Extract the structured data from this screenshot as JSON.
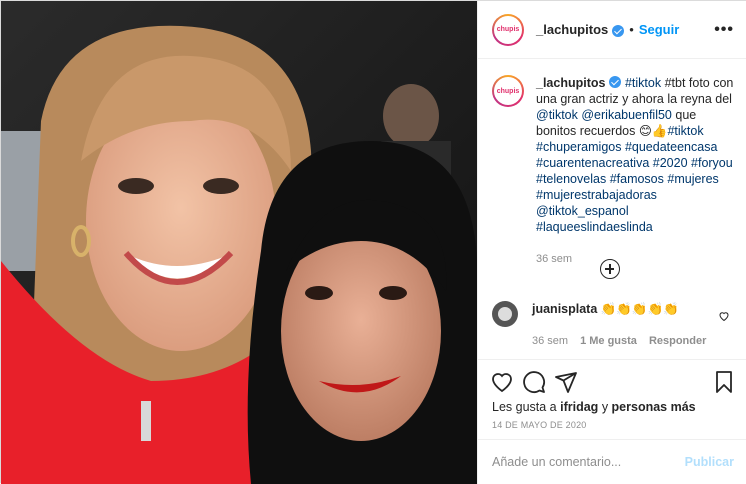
{
  "post": {
    "username": "_lachupitos",
    "follow_label": "Seguir",
    "more_label": "•••",
    "avatar_text": "chupis"
  },
  "caption": {
    "username": "_lachupitos",
    "text_intro": "#tbt foto con una gran actriz y ahora la reyna del",
    "mention_tiktok": "@tiktok",
    "mention_erika": "@erikabuenfil50",
    "text_mid": "que bonitos recuerdos",
    "emoji": "😊👍",
    "hashtags": [
      "#tiktok",
      "#chuperamigos",
      "#quedateencasa",
      "#cuarentenacreativa",
      "#2020",
      "#foryou",
      "#telenovelas",
      "#famosos",
      "#mujeres",
      "#mujerestrabajadoras",
      "@tiktok_espanol",
      "#laqueeslindaeslinda"
    ],
    "age": "36 sem"
  },
  "reply": {
    "username": "juanisplata",
    "text": "👏👏👏👏👏",
    "age": "36 sem",
    "likes": "1 Me gusta",
    "reply_label": "Responder"
  },
  "actions": {
    "likes_prefix": "Les gusta a",
    "liked_by": "ifridag",
    "likes_conj": "y",
    "others": "personas más",
    "date": "14 DE MAYO DE 2020"
  },
  "comment_box": {
    "placeholder": "Añade un comentario...",
    "publish_label": "Publicar"
  },
  "colors": {
    "accent": "#0095f6",
    "publish_disabled": "#b2dffc",
    "hashtag": "#00376b",
    "muted": "#8e8e8e"
  }
}
